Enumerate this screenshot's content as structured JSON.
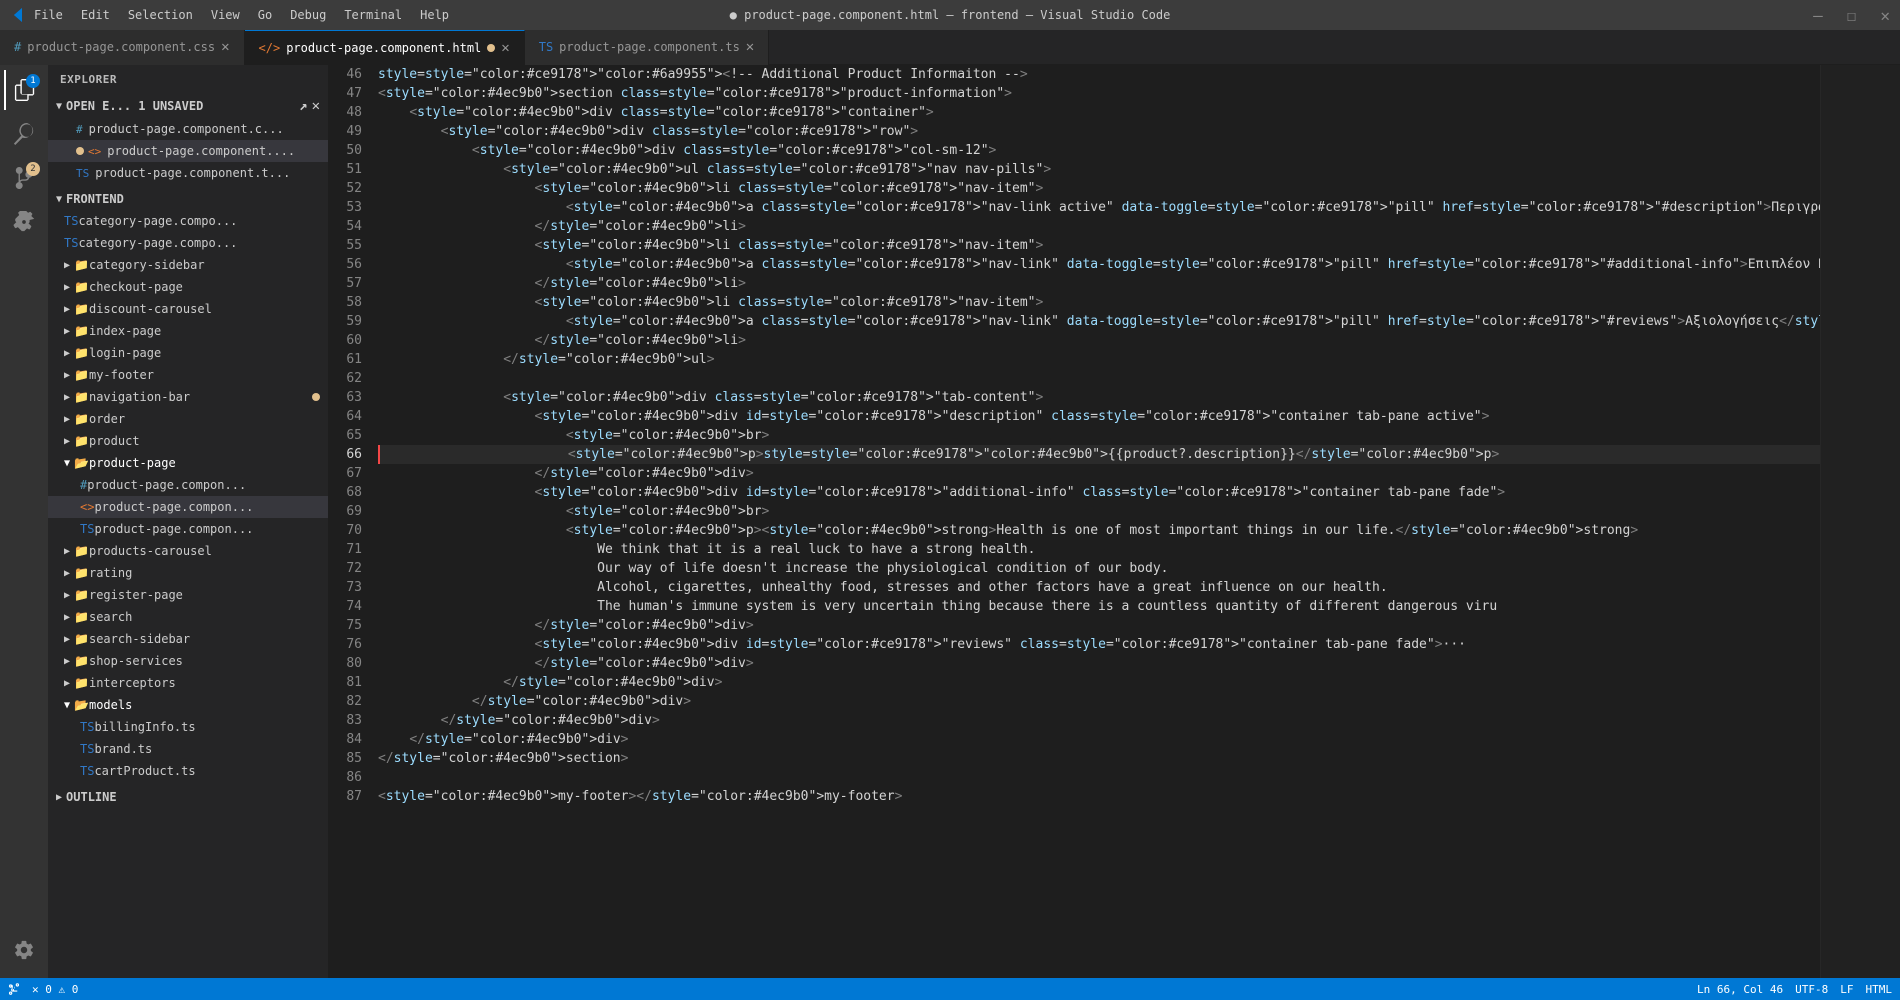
{
  "titleBar": {
    "title": "● product-page.component.html — frontend — Visual Studio Code",
    "menu": [
      "File",
      "Edit",
      "Selection",
      "View",
      "Go",
      "Debug",
      "Terminal",
      "Help"
    ]
  },
  "tabs": [
    {
      "id": "css",
      "label": "product-page.component.css",
      "icon": "css",
      "active": false,
      "modified": false
    },
    {
      "id": "html",
      "label": "product-page.component.html",
      "icon": "html",
      "active": true,
      "modified": true
    },
    {
      "id": "ts",
      "label": "product-page.component.ts",
      "icon": "ts",
      "active": false,
      "modified": false
    }
  ],
  "sidebar": {
    "title": "EXPLORER",
    "openEditors": "OPEN E... 1 UNSAVED",
    "frontendLabel": "FRONTEND",
    "files": [
      {
        "name": "product-page.component.c...",
        "type": "css",
        "level": 1
      },
      {
        "name": "product-page.component....",
        "type": "html",
        "level": 1,
        "modified": true
      },
      {
        "name": "product-page.component.t...",
        "type": "ts",
        "level": 1
      }
    ],
    "folders": [
      {
        "name": "category-page.compo...",
        "type": "ts",
        "level": 2
      },
      {
        "name": "category-page.compo...",
        "type": "ts",
        "level": 2
      },
      {
        "name": "category-sidebar",
        "type": "folder",
        "level": 1
      },
      {
        "name": "checkout-page",
        "type": "folder",
        "level": 1
      },
      {
        "name": "discount-carousel",
        "type": "folder",
        "level": 1
      },
      {
        "name": "index-page",
        "type": "folder",
        "level": 1
      },
      {
        "name": "login-page",
        "type": "folder",
        "level": 1
      },
      {
        "name": "my-footer",
        "type": "folder",
        "level": 1
      },
      {
        "name": "navigation-bar",
        "type": "folder",
        "level": 1,
        "modified": true
      },
      {
        "name": "order",
        "type": "folder",
        "level": 1
      },
      {
        "name": "product",
        "type": "folder",
        "level": 1
      },
      {
        "name": "product-page",
        "type": "folder",
        "level": 1,
        "expanded": true
      },
      {
        "name": "product-page.compon...",
        "type": "css",
        "level": 2
      },
      {
        "name": "product-page.compon...",
        "type": "html",
        "level": 2,
        "active": true
      },
      {
        "name": "product-page.compon...",
        "type": "ts",
        "level": 2
      },
      {
        "name": "products-carousel",
        "type": "folder",
        "level": 1
      },
      {
        "name": "rating",
        "type": "folder",
        "level": 1
      },
      {
        "name": "register-page",
        "type": "folder",
        "level": 1
      },
      {
        "name": "search",
        "type": "folder",
        "level": 1
      },
      {
        "name": "search-sidebar",
        "type": "folder",
        "level": 1
      },
      {
        "name": "shop-services",
        "type": "folder",
        "level": 1
      },
      {
        "name": "interceptors",
        "type": "folder",
        "level": 1
      },
      {
        "name": "models",
        "type": "folder",
        "level": 1,
        "expanded": true
      },
      {
        "name": "billingInfo.ts",
        "type": "ts",
        "level": 2
      },
      {
        "name": "brand.ts",
        "type": "ts",
        "level": 2
      },
      {
        "name": "cartProduct.ts",
        "type": "ts",
        "level": 2
      }
    ]
  },
  "codeLines": [
    {
      "num": 46,
      "content": "<!-- Additional Product Informaiton -->"
    },
    {
      "num": 47,
      "content": "<section class=\"product-information\">"
    },
    {
      "num": 48,
      "content": "    <div class=\"container\">"
    },
    {
      "num": 49,
      "content": "        <div class=\"row\">"
    },
    {
      "num": 50,
      "content": "            <div class=\"col-sm-12\">"
    },
    {
      "num": 51,
      "content": "                <ul class=\"nav nav-pills\">"
    },
    {
      "num": 52,
      "content": "                    <li class=\"nav-item\">"
    },
    {
      "num": 53,
      "content": "                        <a class=\"nav-link active\" data-toggle=\"pill\" href=\"#description\">Περιγραφή</a>"
    },
    {
      "num": 54,
      "content": "                    </li>"
    },
    {
      "num": 55,
      "content": "                    <li class=\"nav-item\">"
    },
    {
      "num": 56,
      "content": "                        <a class=\"nav-link\" data-toggle=\"pill\" href=\"#additional-info\">Επιπλέον Πληροφορίες</a>"
    },
    {
      "num": 57,
      "content": "                    </li>"
    },
    {
      "num": 58,
      "content": "                    <li class=\"nav-item\">"
    },
    {
      "num": 59,
      "content": "                        <a class=\"nav-link\" data-toggle=\"pill\" href=\"#reviews\">Αξιολογήσεις</a>"
    },
    {
      "num": 60,
      "content": "                    </li>"
    },
    {
      "num": 61,
      "content": "                </ul>"
    },
    {
      "num": 62,
      "content": ""
    },
    {
      "num": 63,
      "content": "                <div class=\"tab-content\">"
    },
    {
      "num": 64,
      "content": "                    <div id=\"description\" class=\"container tab-pane active\">"
    },
    {
      "num": 65,
      "content": "                        <br>"
    },
    {
      "num": 66,
      "content": "                        <p>{{product?.description}}</p>",
      "active": true,
      "error": true
    },
    {
      "num": 67,
      "content": "                    </div>"
    },
    {
      "num": 68,
      "content": "                    <div id=\"additional-info\" class=\"container tab-pane fade\">"
    },
    {
      "num": 69,
      "content": "                        <br>"
    },
    {
      "num": 70,
      "content": "                        <p><strong>Health is one of most important things in our life.</strong>"
    },
    {
      "num": 71,
      "content": "                            We think that it is a real luck to have a strong health."
    },
    {
      "num": 72,
      "content": "                            Our way of life doesn't increase the physiological condition of our body."
    },
    {
      "num": 73,
      "content": "                            Alcohol, cigarettes, unhealthy food, stresses and other factors have a great influence on our health."
    },
    {
      "num": 74,
      "content": "                            The human's immune system is very uncertain thing because there is a countless quantity of different dangerous viru"
    },
    {
      "num": 75,
      "content": "                    </div>"
    },
    {
      "num": 76,
      "content": "                    <div id=\"reviews\" class=\"container tab-pane fade\">···"
    },
    {
      "num": 80,
      "content": "                    </div>"
    },
    {
      "num": 81,
      "content": "                </div>"
    },
    {
      "num": 82,
      "content": "            </div>"
    },
    {
      "num": 83,
      "content": "        </div>"
    },
    {
      "num": 84,
      "content": "    </div>"
    },
    {
      "num": 85,
      "content": "</section>"
    },
    {
      "num": 86,
      "content": ""
    },
    {
      "num": 87,
      "content": "<my-footer></my-footer>"
    }
  ],
  "statusBar": {
    "gitBranch": "",
    "errors": "0",
    "warnings": "0",
    "encoding": "UTF-8",
    "lineEnding": "LF",
    "language": "HTML",
    "cursor": "Ln 66, Col 46"
  },
  "outline": {
    "label": "OUTLINE"
  }
}
